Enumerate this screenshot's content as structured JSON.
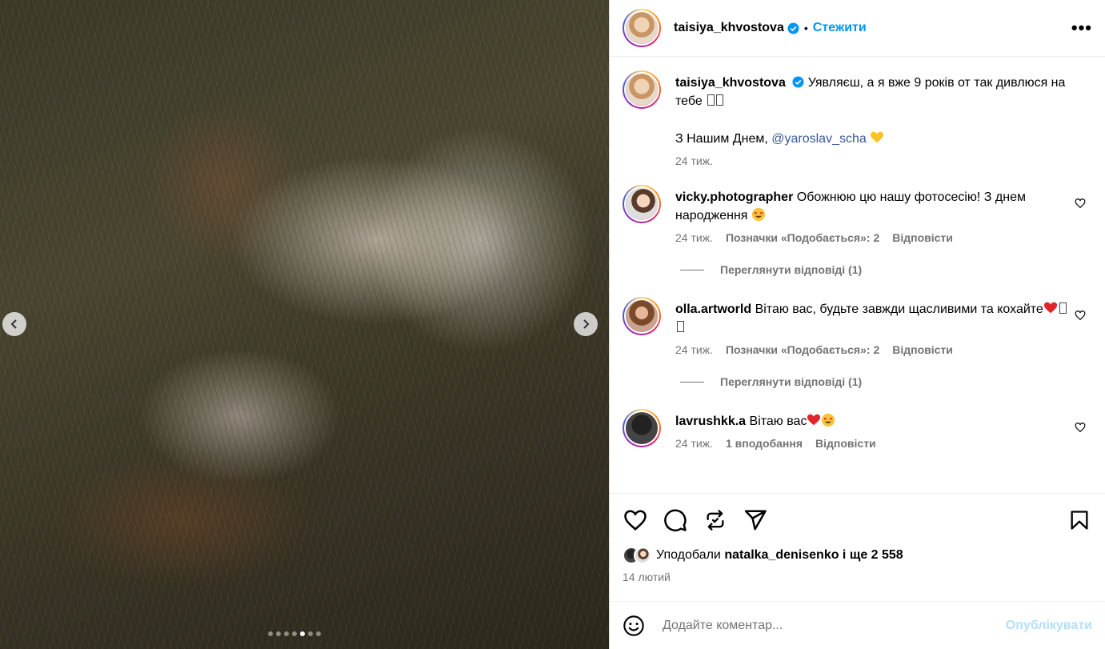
{
  "post": {
    "author": "taisiya_khvostova",
    "separator": "•",
    "follow_label": "Стежити",
    "more_label": "•••",
    "carousel": {
      "total": 7,
      "active_index": 4
    }
  },
  "caption": {
    "username": "taisiya_khvostova",
    "text_line1": "Уявляєш, а я вже 9 років от так дивлюся на тебе",
    "text_line2_prefix": "З Нашим Днем, ",
    "mention": "@yaroslav_scha",
    "time": "24 тиж."
  },
  "comments": [
    {
      "username": "vicky.photographer",
      "text": "Обожнюю цю нашу фотосесію! З днем народження",
      "time": "24 тиж.",
      "likes": "Позначки «Подобається»: 2",
      "reply_label": "Відповісти",
      "view_replies": "Переглянути відповіді (1)"
    },
    {
      "username": "olla.artworld",
      "text": "Вітаю вас, будьте завжди щасливими та кохайте",
      "time": "24 тиж.",
      "likes": "Позначки «Подобається»: 2",
      "reply_label": "Відповісти",
      "view_replies": "Переглянути відповіді (1)"
    },
    {
      "username": "lavrushkk.a",
      "text": "Вітаю вас",
      "time": "24 тиж.",
      "likes": "1 вподобання",
      "reply_label": "Відповісти"
    }
  ],
  "footer": {
    "liked_by_prefix": "Уподобали ",
    "liked_by_user": "natalka_denisenko",
    "liked_by_suffix": " і ще 2 558",
    "date": "14 лютий",
    "comment_placeholder": "Додайте коментар...",
    "publish_label": "Опублікувати"
  },
  "colors": {
    "accent": "#0095f6",
    "publish_disabled": "#b2dffc",
    "verified": "#0095f6",
    "mention": "#385898",
    "secondary_text": "#737373"
  },
  "icons": [
    "verified-badge-icon",
    "chevron-left-icon",
    "chevron-right-icon",
    "heart-icon",
    "comment-icon",
    "repost-icon",
    "share-icon",
    "bookmark-icon",
    "emoji-icon",
    "more-icon"
  ]
}
